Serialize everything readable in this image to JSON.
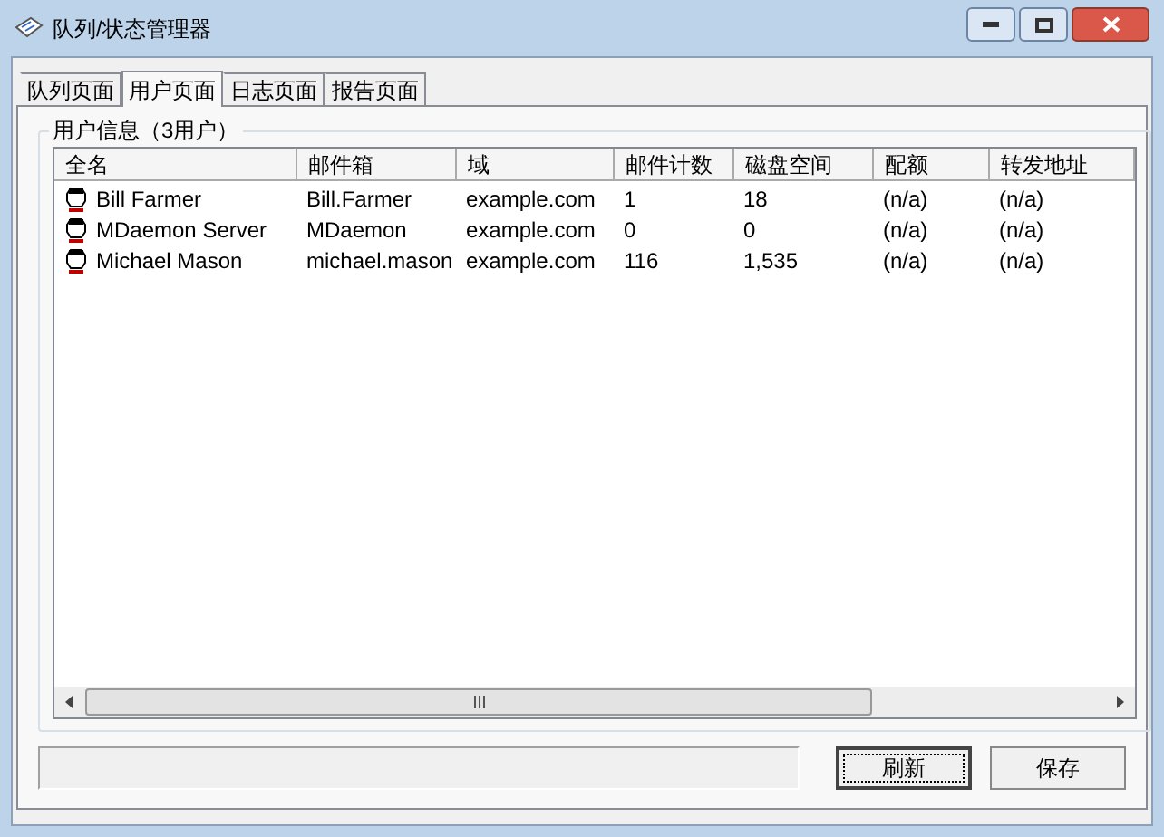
{
  "window": {
    "title": "队列/状态管理器"
  },
  "tabs": [
    {
      "label": "队列页面",
      "selected": false
    },
    {
      "label": "用户页面",
      "selected": true
    },
    {
      "label": "日志页面",
      "selected": false
    },
    {
      "label": "报告页面",
      "selected": false
    }
  ],
  "group": {
    "title": "用户信息（3用户）"
  },
  "table": {
    "columns": [
      "全名",
      "邮件箱",
      "域",
      "邮件计数",
      "磁盘空间",
      "配额",
      "转发地址"
    ],
    "rows": [
      [
        "Bill Farmer",
        "Bill.Farmer",
        "example.com",
        "1",
        "18",
        "(n/a)",
        "(n/a)"
      ],
      [
        "MDaemon Server",
        "MDaemon",
        "example.com",
        "0",
        "0",
        "(n/a)",
        "(n/a)"
      ],
      [
        "Michael Mason",
        "michael.mason",
        "example.com",
        "116",
        "1,535",
        "(n/a)",
        "(n/a)"
      ]
    ]
  },
  "buttons": [
    {
      "label": "刷新",
      "focused": true
    },
    {
      "label": "保存",
      "focused": false
    }
  ]
}
